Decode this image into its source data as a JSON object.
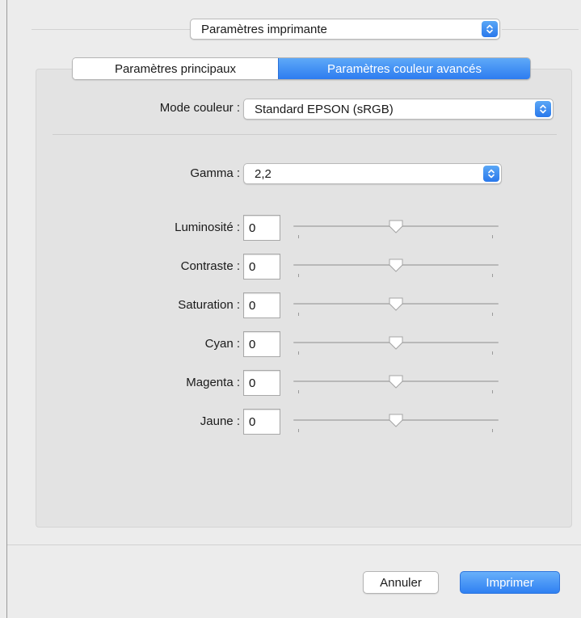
{
  "header": {
    "preset_popup": {
      "value": "Paramètres imprimante"
    }
  },
  "tabs": [
    {
      "label": "Paramètres principaux",
      "active": false
    },
    {
      "label": "Paramètres couleur avancés",
      "active": true
    }
  ],
  "color_mode": {
    "label": "Mode couleur :",
    "value": "Standard EPSON (sRGB)"
  },
  "gamma": {
    "label": "Gamma :",
    "value": "2,2"
  },
  "adjustments": [
    {
      "label": "Luminosité :",
      "value": "0",
      "slider_level": 0.5
    },
    {
      "label": "Contraste :",
      "value": "0",
      "slider_level": 0.5
    },
    {
      "label": "Saturation :",
      "value": "0",
      "slider_level": 0.5
    },
    {
      "label": "Cyan :",
      "value": "0",
      "slider_level": 0.5
    },
    {
      "label": "Magenta :",
      "value": "0",
      "slider_level": 0.5
    },
    {
      "label": "Jaune :",
      "value": "0",
      "slider_level": 0.5
    }
  ],
  "footer": {
    "cancel_label": "Annuler",
    "print_label": "Imprimer"
  },
  "colors": {
    "accent": "#2d7cf0",
    "panel": "#e3e3e3",
    "window": "#ececec"
  }
}
